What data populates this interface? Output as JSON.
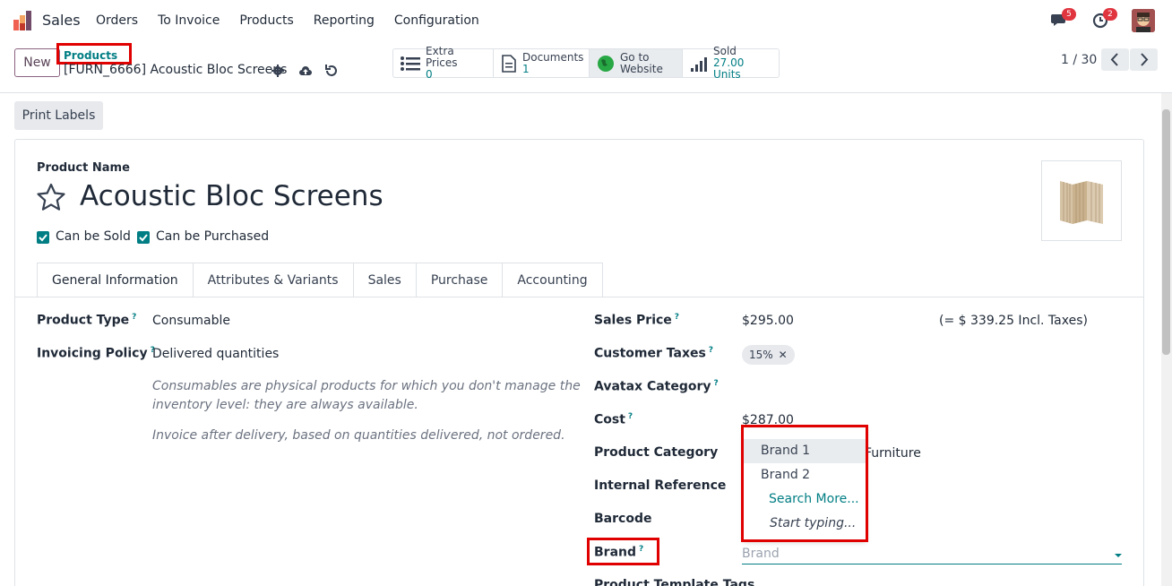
{
  "navbar": {
    "app_name": "Sales",
    "menu": [
      "Orders",
      "To Invoice",
      "Products",
      "Reporting",
      "Configuration"
    ],
    "messages_count": "5",
    "activities_count": "2"
  },
  "control_panel": {
    "new_label": "New",
    "breadcrumb_parent": "Products",
    "breadcrumb_current": "[FURN_6666] Acoustic Bloc Screens",
    "smart_buttons": [
      {
        "label": "Extra Prices",
        "value": "0"
      },
      {
        "label": "Documents",
        "value": "1"
      },
      {
        "label": "Go to",
        "value": "Website"
      },
      {
        "label": "Sold",
        "value": "27.00 Units"
      }
    ],
    "pager": "1 / 30"
  },
  "actions": {
    "print_labels": "Print Labels"
  },
  "form": {
    "product_name_label": "Product Name",
    "product_name": "Acoustic Bloc Screens",
    "can_be_sold": "Can be Sold",
    "can_be_purchased": "Can be Purchased",
    "tabs": [
      "General Information",
      "Attributes & Variants",
      "Sales",
      "Purchase",
      "Accounting"
    ],
    "left": {
      "product_type_label": "Product Type",
      "product_type": "Consumable",
      "invoicing_policy_label": "Invoicing Policy",
      "invoicing_policy": "Delivered quantities",
      "hint1_line1": "Consumables are physical products for which you don't manage the",
      "hint1_line2": "inventory level: they are always available.",
      "hint2": "Invoice after delivery, based on quantities delivered, not ordered."
    },
    "right": {
      "sales_price_label": "Sales Price",
      "sales_price": "$295.00",
      "incl_taxes": "(= $ 339.25 Incl. Taxes)",
      "customer_taxes_label": "Customer Taxes",
      "tax_tag": "15%",
      "avatax_label": "Avatax Category",
      "cost_label": "Cost",
      "cost": "$287.00",
      "product_category_label": "Product Category",
      "product_category_tail": "Furniture",
      "internal_ref_label": "Internal Reference",
      "barcode_label": "Barcode",
      "brand_label": "Brand",
      "brand_placeholder": "Brand",
      "template_tags_label": "Product Template Tags"
    },
    "brand_dropdown": [
      "Brand 1",
      "Brand 2",
      "Search More...",
      "Start typing..."
    ]
  },
  "colors": {
    "accent": "#017e84",
    "highlight": "#e00000",
    "brand_purple": "#714b67"
  }
}
